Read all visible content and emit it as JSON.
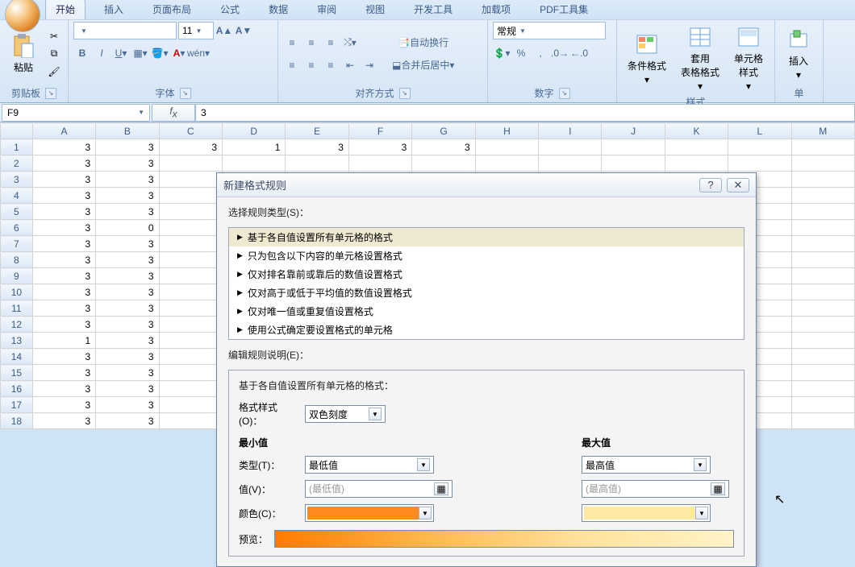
{
  "tabs": [
    "开始",
    "插入",
    "页面布局",
    "公式",
    "数据",
    "审阅",
    "视图",
    "开发工具",
    "加载项",
    "PDF工具集"
  ],
  "active_tab": 0,
  "ribbon": {
    "clipboard": {
      "title": "剪贴板",
      "paste": "粘贴"
    },
    "font": {
      "title": "字体",
      "name": "",
      "size": "11"
    },
    "align": {
      "title": "对齐方式",
      "wrap": "自动换行",
      "merge": "合并后居中"
    },
    "number": {
      "title": "数字",
      "format": "常规"
    },
    "styles": {
      "title": "样式",
      "cond": "条件格式",
      "table": "套用\n表格格式",
      "cell": "单元格\n样式"
    },
    "cells": {
      "title": "单",
      "insert": "插入"
    }
  },
  "namebox": "F9",
  "formula": "3",
  "columns": [
    "A",
    "B",
    "C",
    "D",
    "E",
    "F",
    "G",
    "H",
    "I",
    "J",
    "K",
    "L",
    "M"
  ],
  "rows": [
    {
      "n": 1,
      "v": [
        3,
        3,
        3,
        1,
        3,
        3,
        3
      ]
    },
    {
      "n": 2,
      "v": [
        3,
        3
      ]
    },
    {
      "n": 3,
      "v": [
        3,
        3
      ]
    },
    {
      "n": 4,
      "v": [
        3,
        3
      ]
    },
    {
      "n": 5,
      "v": [
        3,
        3
      ]
    },
    {
      "n": 6,
      "v": [
        3,
        0
      ]
    },
    {
      "n": 7,
      "v": [
        3,
        3
      ]
    },
    {
      "n": 8,
      "v": [
        3,
        3
      ]
    },
    {
      "n": 9,
      "v": [
        3,
        3
      ]
    },
    {
      "n": 10,
      "v": [
        3,
        3
      ]
    },
    {
      "n": 11,
      "v": [
        3,
        3
      ]
    },
    {
      "n": 12,
      "v": [
        3,
        3
      ]
    },
    {
      "n": 13,
      "v": [
        1,
        3
      ]
    },
    {
      "n": 14,
      "v": [
        3,
        3
      ]
    },
    {
      "n": 15,
      "v": [
        3,
        3
      ]
    },
    {
      "n": 16,
      "v": [
        3,
        3
      ]
    },
    {
      "n": 17,
      "v": [
        3,
        3
      ]
    },
    {
      "n": 18,
      "v": [
        3,
        3
      ]
    }
  ],
  "dialog": {
    "title": "新建格式规则",
    "select_label": "选择规则类型(S)：",
    "rules": [
      "基于各自值设置所有单元格的格式",
      "只为包含以下内容的单元格设置格式",
      "仅对排名靠前或靠后的数值设置格式",
      "仅对高于或低于平均值的数值设置格式",
      "仅对唯一值或重复值设置格式",
      "使用公式确定要设置格式的单元格"
    ],
    "selected_rule": 0,
    "edit_label": "编辑规则说明(E)：",
    "format_desc": "基于各自值设置所有单元格的格式：",
    "style_label": "格式样式(O)：",
    "style_value": "双色刻度",
    "min_header": "最小值",
    "max_header": "最大值",
    "type_label": "类型(T)：",
    "value_label": "值(V)：",
    "color_label": "颜色(C)：",
    "preview_label": "预览：",
    "min_type": "最低值",
    "max_type": "最高值",
    "min_value_ph": "(最低值)",
    "max_value_ph": "(最高值)",
    "min_color": "#ff8a1f",
    "max_color": "#ffe9a3"
  }
}
